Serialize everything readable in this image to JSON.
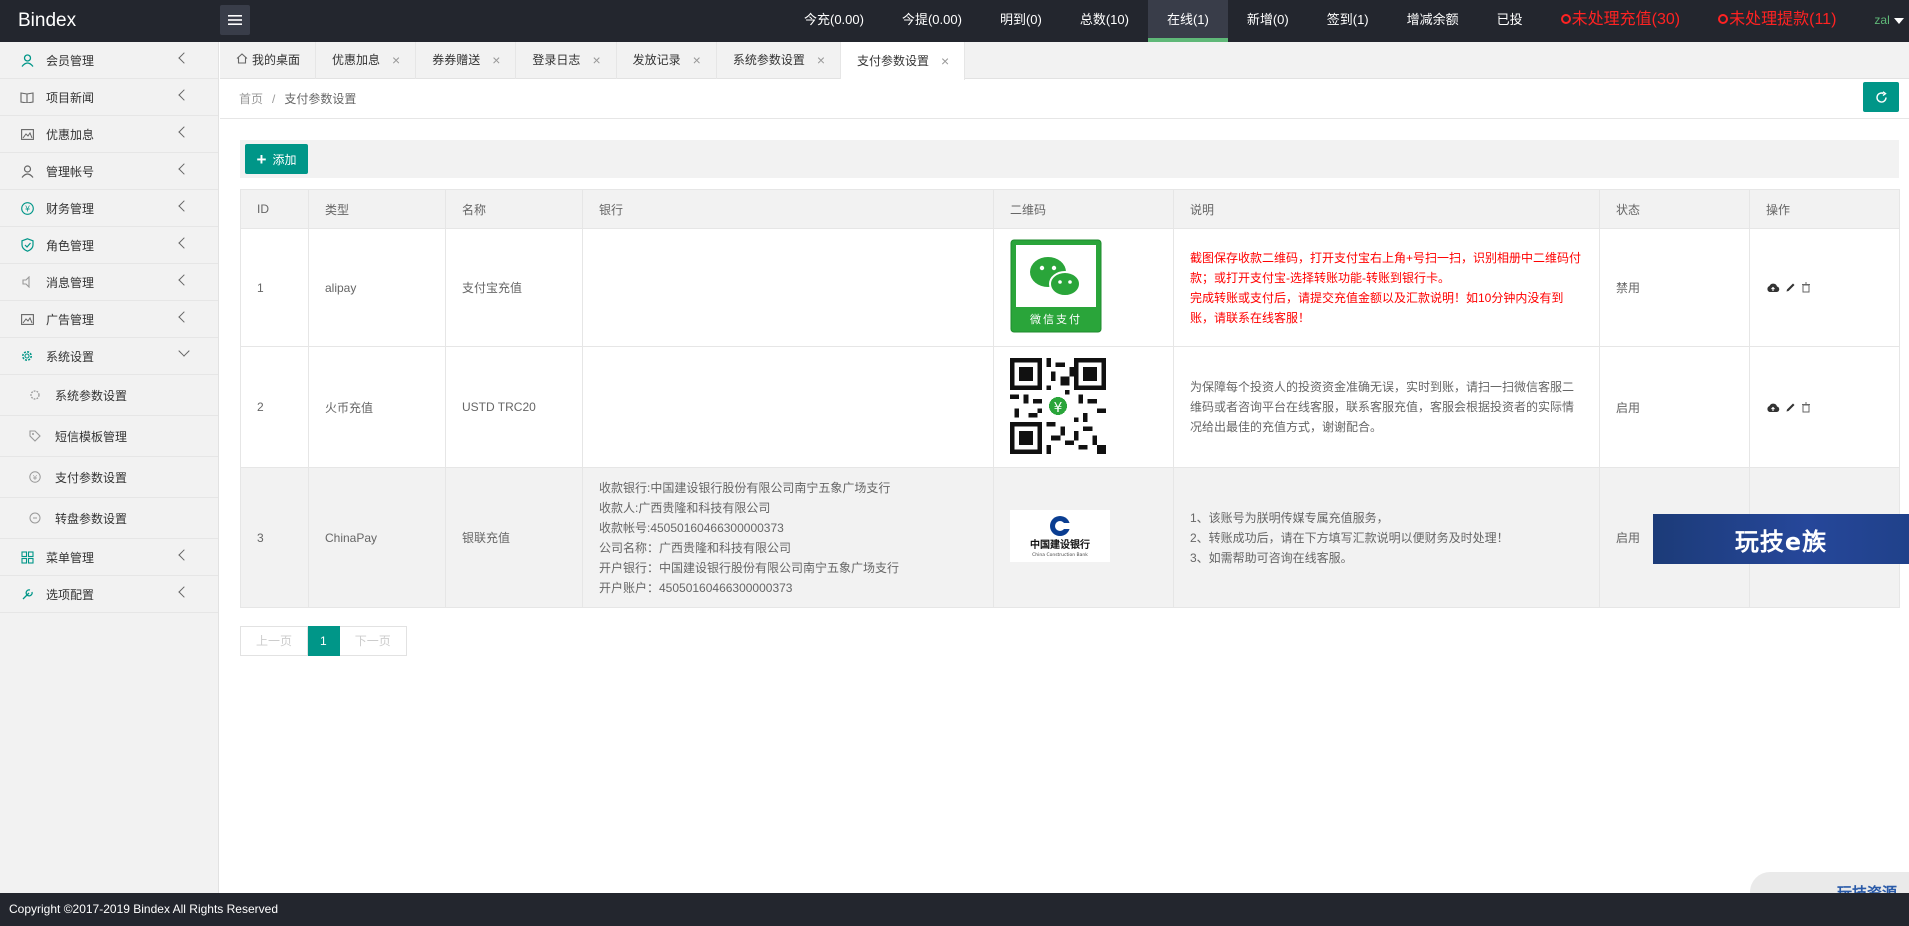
{
  "header": {
    "logo": "Bindex",
    "nav": [
      {
        "label": "今充(0.00)",
        "active": false
      },
      {
        "label": "今提(0.00)",
        "active": false
      },
      {
        "label": "明到(0)",
        "active": false
      },
      {
        "label": "总数(10)",
        "active": false
      },
      {
        "label": "在线(1)",
        "active": true
      },
      {
        "label": "新增(0)",
        "active": false
      },
      {
        "label": "签到(1)",
        "active": false
      },
      {
        "label": "增减余额",
        "active": false
      },
      {
        "label": "已投",
        "active": false
      }
    ],
    "alert_recharge": "未处理充值(30)",
    "alert_withdraw": "未处理提款(11)",
    "user": "zal"
  },
  "sidebar": {
    "items": [
      {
        "label": "会员管理",
        "icon": "user-icon"
      },
      {
        "label": "项目新闻",
        "icon": "book-icon"
      },
      {
        "label": "优惠加息",
        "icon": "image-icon"
      },
      {
        "label": "管理帐号",
        "icon": "account-icon"
      },
      {
        "label": "财务管理",
        "icon": "yen-icon"
      },
      {
        "label": "角色管理",
        "icon": "shield-icon"
      },
      {
        "label": "消息管理",
        "icon": "speaker-icon"
      },
      {
        "label": "广告管理",
        "icon": "picture-icon"
      },
      {
        "label": "系统设置",
        "icon": "gear-icon"
      }
    ],
    "sub_items": [
      {
        "label": "系统参数设置",
        "icon": "gear-small-icon"
      },
      {
        "label": "短信模板管理",
        "icon": "tag-icon"
      },
      {
        "label": "支付参数设置",
        "icon": "yen-small-icon"
      },
      {
        "label": "转盘参数设置",
        "icon": "circle-icon"
      }
    ],
    "items_after": [
      {
        "label": "菜单管理",
        "icon": "grid-icon"
      },
      {
        "label": "选项配置",
        "icon": "tools-icon"
      }
    ]
  },
  "tabs": [
    {
      "label": "我的桌面",
      "closable": false
    },
    {
      "label": "优惠加息",
      "closable": true
    },
    {
      "label": "券券赠送",
      "closable": true
    },
    {
      "label": "登录日志",
      "closable": true
    },
    {
      "label": "发放记录",
      "closable": true
    },
    {
      "label": "系统参数设置",
      "closable": true
    },
    {
      "label": "支付参数设置",
      "closable": true,
      "active": true
    }
  ],
  "breadcrumb": {
    "home": "首页",
    "sep": "/",
    "current": "支付参数设置"
  },
  "toolbar": {
    "add_label": "添加"
  },
  "table": {
    "headers": [
      "ID",
      "类型",
      "名称",
      "银行",
      "二维码",
      "说明",
      "状态",
      "操作"
    ],
    "rows": [
      {
        "id": "1",
        "type": "alipay",
        "name": "支付宝充值",
        "bank": [],
        "qr": "wechat-pay",
        "qr_caption": "微信支付",
        "desc": [
          "截图保存收款二维码，打开支付宝右上角+号扫一扫，识别相册中二维码付款；或打开支付宝-选择转账功能-转账到银行卡。",
          "完成转账或支付后，请提交充值金额以及汇款说明！如10分钟内没有到账，请联系在线客服！"
        ],
        "desc_red": true,
        "status": "禁用"
      },
      {
        "id": "2",
        "type": "火币充值",
        "name": "USTD TRC20",
        "bank": [],
        "qr": "qr-code",
        "desc": [
          "为保障每个投资人的投资资金准确无误，实时到账，请扫一扫微信客服二维码或者咨询平台在线客服，联系客服充值，客服会根据投资者的实际情况给出最佳的充值方式，谢谢配合。"
        ],
        "desc_red": false,
        "status": "启用"
      },
      {
        "id": "3",
        "type": "ChinaPay",
        "name": "银联充值",
        "bank": [
          "收款银行:中国建设银行股份有限公司南宁五象广场支行",
          "收款人:广西贵隆和科技有限公司",
          "收款帐号:45050160466300000373",
          "公司名称：广西贵隆和科技有限公司",
          "开户银行：中国建设银行股份有限公司南宁五象广场支行",
          "开户账户：45050160466300000373"
        ],
        "qr": "ccb-logo",
        "qr_caption": "中国建设银行",
        "qr_subcaption": "China Construction Bank",
        "desc": [
          "1、该账号为朕明传媒专属充值服务，",
          "2、转账成功后，请在下方填写汇款说明以便财务及时处理！",
          "3、如需帮助可咨询在线客服。"
        ],
        "desc_red": false,
        "status": "启用"
      }
    ]
  },
  "pagination": {
    "prev": "上一页",
    "current": "1",
    "next": "下一页"
  },
  "footer": {
    "copyright": "Copyright ©2017-2019 Bindex All Rights Reserved"
  },
  "watermarks": {
    "banner": "玩技e族",
    "badge": "玩技资源"
  },
  "colors": {
    "primary": "#009688",
    "header_bg": "#23262e",
    "alert": "#ff2222",
    "active_bar": "#5fb878"
  }
}
